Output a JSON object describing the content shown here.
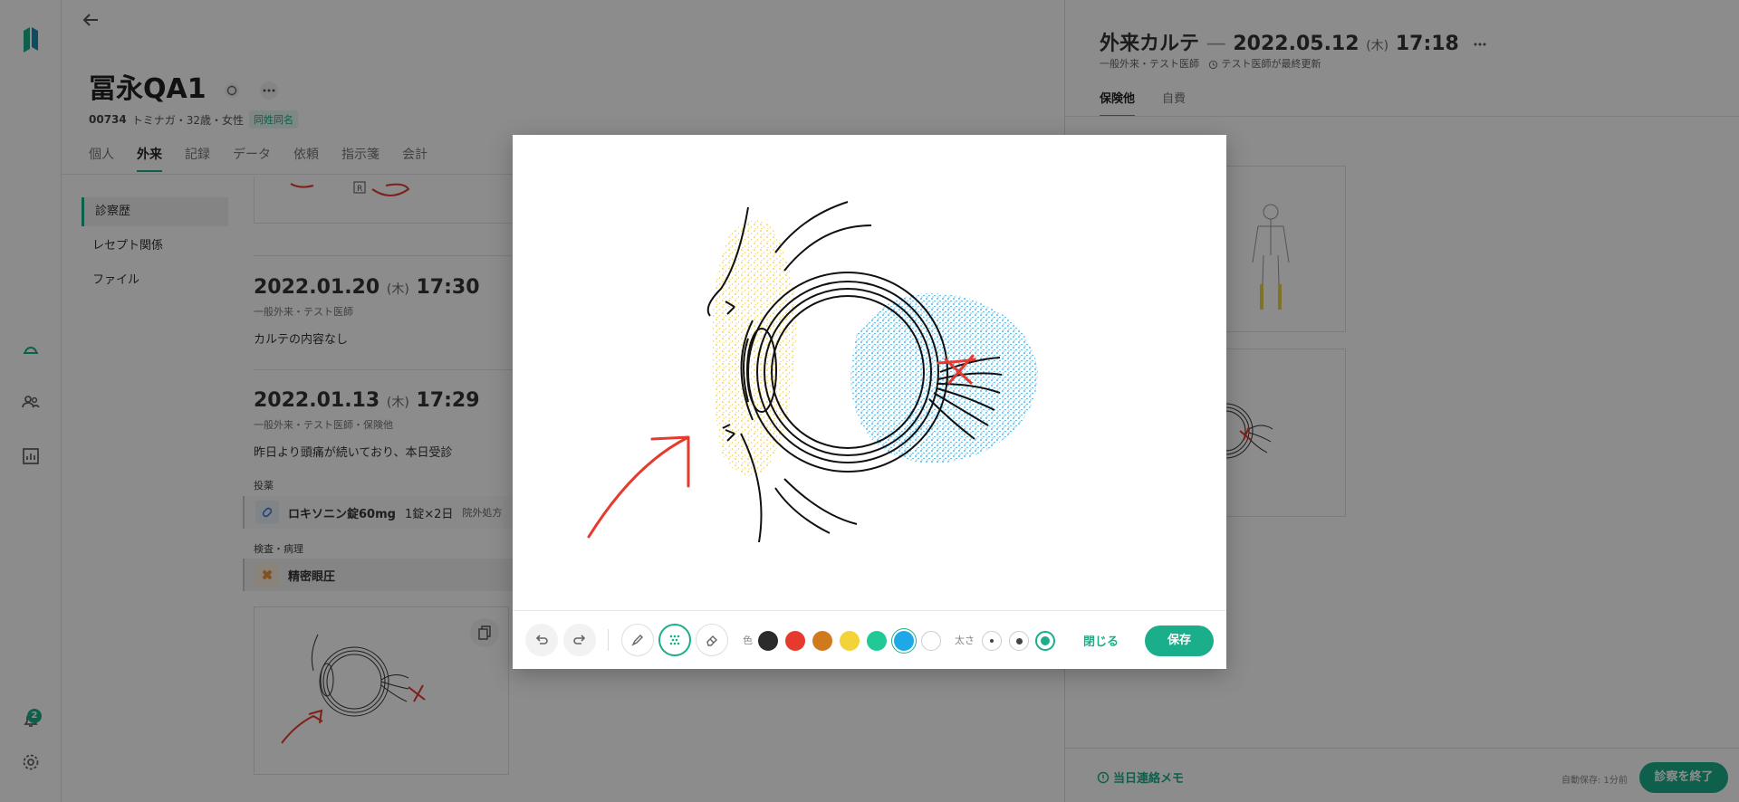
{
  "patient": {
    "name": "冨永QA1",
    "id": "00734",
    "details": "トミナガ・32歳・女性",
    "tag": "同姓同名",
    "tabs": [
      "個人",
      "外来",
      "記録",
      "データ",
      "依頼",
      "指示箋",
      "会計"
    ],
    "active_tab": "外来"
  },
  "subnav": {
    "items": [
      "診察歴",
      "レセプト関係",
      "ファイル"
    ]
  },
  "history": {
    "entry1": {
      "date": "2022.01.20",
      "dow": "(木)",
      "time": "17:30",
      "sub": "一般外来・テスト医師",
      "note": "カルテの内容なし"
    },
    "entry2": {
      "date": "2022.01.13",
      "dow": "(木)",
      "time": "17:29",
      "sub": "一般外来・テスト医師・保険他",
      "note": "昨日より頭痛が続いており、本日受診",
      "med_label": "投薬",
      "med_name": "ロキソニン錠60mg",
      "med_dose": "1錠×2日",
      "med_extra": "院外処方",
      "exam_label": "検査・病理",
      "exam_name": "精密眼圧"
    }
  },
  "chart": {
    "title": "外来カルテ",
    "dash": "—",
    "date": "2022.05.12",
    "dow": "(木)",
    "time": "17:18",
    "sub_left": "一般外来・テスト医師",
    "sub_right": "テスト医師が最終更新",
    "tabs": [
      "保険他",
      "自費"
    ],
    "memo": "当日連絡メモ",
    "autosave": "自動保存: 1分前",
    "end_button": "診察を終了"
  },
  "notifications": {
    "count": "2"
  },
  "modal": {
    "color_label": "色",
    "size_label": "太さ",
    "close_label": "閉じる",
    "save_label": "保存",
    "colors": [
      "#2b2b2b",
      "#e53a2d",
      "#d07a1e",
      "#f2d338",
      "#20c997",
      "#1ea8e8",
      "#ffffff"
    ],
    "selected_color": "#1ea8e8",
    "selected_tool": "spray"
  }
}
